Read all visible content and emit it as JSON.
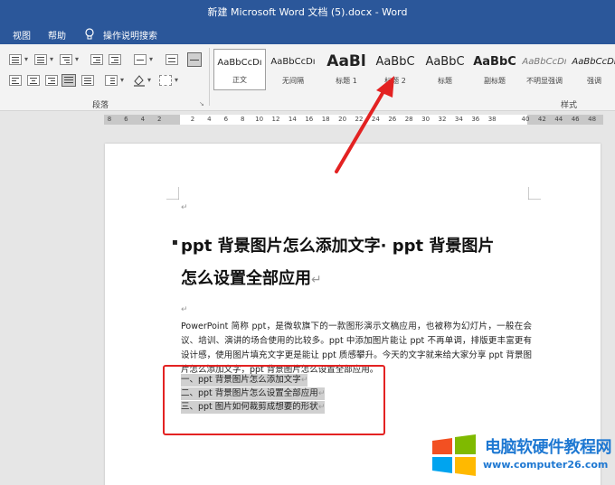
{
  "window": {
    "title": "新建 Microsoft Word 文档 (5).docx  -  Word"
  },
  "menu": {
    "view": "视图",
    "help": "帮助",
    "tell_me": "操作说明搜索"
  },
  "ribbon": {
    "paragraph_group": "段落",
    "styles_group": "样式",
    "styles": [
      {
        "sample": "AaBbCcDı",
        "name": "正文",
        "selected": true
      },
      {
        "sample": "AaBbCcDı",
        "name": "无间隔"
      },
      {
        "sample": "AaBl",
        "name": "标题 1"
      },
      {
        "sample": "AaBbC",
        "name": "标题 2"
      },
      {
        "sample": "AaBbC",
        "name": "标题"
      },
      {
        "sample": "AaBbC",
        "name": "副标题"
      },
      {
        "sample": "AaBbCcDı",
        "name": "不明显强调"
      },
      {
        "sample": "AaBbCcDı",
        "name": "强调"
      }
    ]
  },
  "ruler": {
    "ticks": [
      "8",
      "6",
      "4",
      "2",
      "",
      "2",
      "4",
      "6",
      "8",
      "10",
      "12",
      "14",
      "16",
      "18",
      "20",
      "22",
      "24",
      "26",
      "28",
      "30",
      "32",
      "34",
      "36",
      "38",
      "",
      "40",
      "42",
      "44",
      "46",
      "48"
    ]
  },
  "document": {
    "title_line1": "ppt 背景图片怎么添加文字· ppt 背景图片",
    "title_line2": "怎么设置全部应用",
    "paragraph": "PowerPoint 简称 ppt，是微软旗下的一款图形演示文稿应用，也被称为幻灯片，一般在会议、培训、演讲的场合使用的比较多。ppt 中添加图片能让 ppt 不再单调，排版更丰富更有设计感，使用图片填充文字更是能让 ppt 质感攀升。今天的文字就来给大家分享 ppt 背景图片怎么添加文字，ppt 背景图片怎么设置全部应用。",
    "list": [
      "一、ppt 背景图片怎么添加文字",
      "二、ppt 背景图片怎么设置全部应用",
      "三、ppt 图片如何裁剪成想要的形状"
    ],
    "paragraph_mark": "↵"
  },
  "watermark": {
    "title": "电脑软硬件教程网",
    "url": "www.computer26.com"
  },
  "colors": {
    "titlebar": "#2b579a",
    "annotation": "#e32222",
    "watermark": "#1e78d2"
  }
}
